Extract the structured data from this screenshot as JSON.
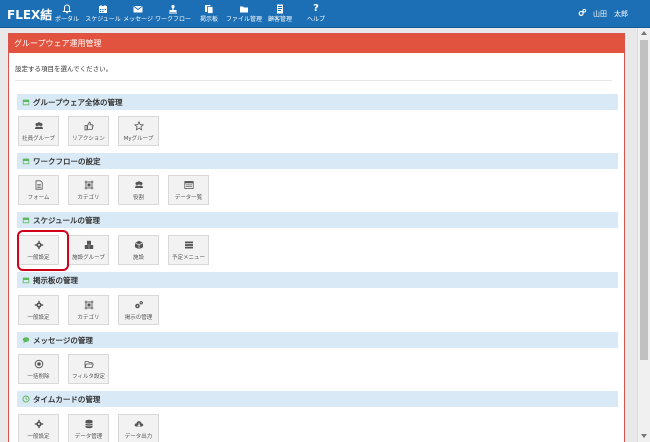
{
  "app": {
    "logo": "FLEX結",
    "accent_color": "#1c6fb5",
    "panel_color": "#e2533f"
  },
  "nav": [
    {
      "label": "ポータル",
      "icon": "bell-icon"
    },
    {
      "label": "スケジュール",
      "icon": "calendar-icon"
    },
    {
      "label": "メッセージ",
      "icon": "envelope-icon"
    },
    {
      "label": "ワークフロー",
      "icon": "stamp-icon"
    },
    {
      "label": "掲示板",
      "icon": "documents-icon"
    },
    {
      "label": "ファイル管理",
      "icon": "folder-icon"
    },
    {
      "label": "顧客管理",
      "icon": "contacts-icon"
    },
    {
      "label": "ヘルプ",
      "icon": "question-icon"
    }
  ],
  "user": {
    "name": "山田　太郎",
    "settings_icon": "gears-icon"
  },
  "panel": {
    "title": "グループウェア運用管理",
    "intro": "設定する項目を選んでください。"
  },
  "sections": [
    {
      "title": "グループウェア全体の管理",
      "icon": "calendar-icon",
      "items": [
        {
          "label": "社員グループ",
          "icon": "users-icon"
        },
        {
          "label": "リアクション",
          "icon": "thumbs-up-icon"
        },
        {
          "label": "Myグループ",
          "icon": "star-icon"
        }
      ]
    },
    {
      "title": "ワークフローの設定",
      "icon": "calendar-icon",
      "items": [
        {
          "label": "フォーム",
          "icon": "file-icon"
        },
        {
          "label": "カテゴリ",
          "icon": "frame-icon"
        },
        {
          "label": "役割",
          "icon": "users-icon"
        },
        {
          "label": "データ一覧",
          "icon": "list-icon"
        }
      ]
    },
    {
      "title": "スケジュールの管理",
      "icon": "calendar-icon",
      "items": [
        {
          "label": "一般設定",
          "icon": "gear-icon"
        },
        {
          "label": "施設グループ",
          "icon": "cubes-icon"
        },
        {
          "label": "施設",
          "icon": "cube-icon"
        },
        {
          "label": "予定メニュー",
          "icon": "menu-list-icon"
        }
      ]
    },
    {
      "title": "掲示板の管理",
      "icon": "calendar-icon",
      "items": [
        {
          "label": "一般設定",
          "icon": "gear-icon"
        },
        {
          "label": "カテゴリ",
          "icon": "frame-icon"
        },
        {
          "label": "掲示の管理",
          "icon": "gears-icon"
        }
      ]
    },
    {
      "title": "メッセージの管理",
      "icon": "comment-icon",
      "items": [
        {
          "label": "一括削除",
          "icon": "dot-circle-icon"
        },
        {
          "label": "フィルタ設定",
          "icon": "folder-open-icon"
        }
      ]
    },
    {
      "title": "タイムカードの管理",
      "icon": "clock-icon",
      "items": [
        {
          "label": "一般設定",
          "icon": "gear-icon"
        },
        {
          "label": "データ管理",
          "icon": "database-icon"
        },
        {
          "label": "データ出力",
          "icon": "cloud-download-icon"
        }
      ]
    }
  ]
}
